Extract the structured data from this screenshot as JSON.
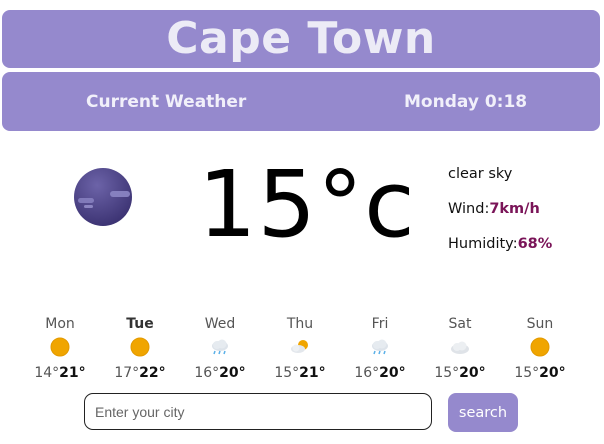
{
  "header": {
    "city": "Cape Town"
  },
  "subheader": {
    "label": "Current Weather",
    "datetime": "Monday 0:18"
  },
  "current": {
    "temperature": "15",
    "unit": "°c",
    "description": "clear sky",
    "wind_label": "Wind:",
    "wind_value": "7km/h",
    "humidity_label": "Humidity:",
    "humidity_value": "68%",
    "icon": "night-clear-moon-icon"
  },
  "forecast": [
    {
      "day": "Mon",
      "icon": "sun-icon",
      "min": "14°",
      "max": "21°"
    },
    {
      "day": "Tue",
      "icon": "sun-icon",
      "min": "17°",
      "max": "22°"
    },
    {
      "day": "Wed",
      "icon": "cloud-rain-icon",
      "min": "16°",
      "max": "20°"
    },
    {
      "day": "Thu",
      "icon": "sun-cloud-icon",
      "min": "15°",
      "max": "21°"
    },
    {
      "day": "Fri",
      "icon": "cloud-rain-icon",
      "min": "16°",
      "max": "20°"
    },
    {
      "day": "Sat",
      "icon": "cloud-icon",
      "min": "15°",
      "max": "20°"
    },
    {
      "day": "Sun",
      "icon": "sun-icon",
      "min": "15°",
      "max": "20°"
    }
  ],
  "search": {
    "placeholder": "Enter your city",
    "button": "search"
  },
  "colors": {
    "accent": "#9589cd",
    "detail_value": "#7a1458",
    "sun": "#f0a500"
  }
}
